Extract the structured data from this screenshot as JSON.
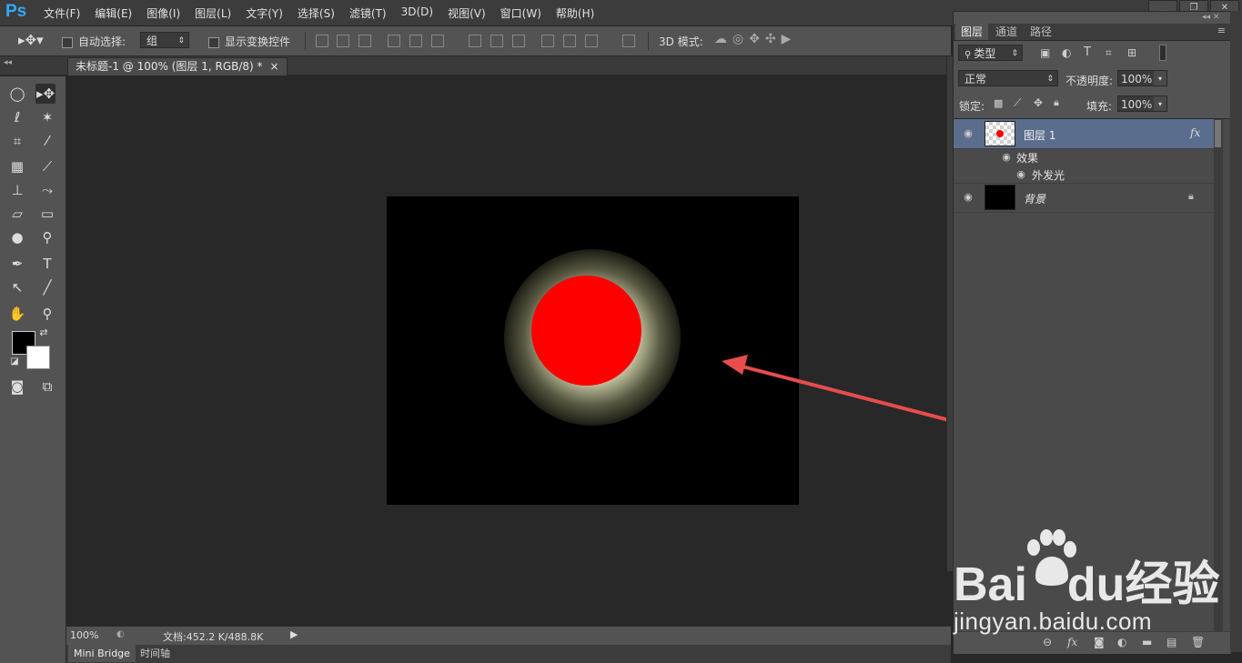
{
  "app": {
    "logo": "Ps",
    "menu": [
      "文件(F)",
      "编辑(E)",
      "图像(I)",
      "图层(L)",
      "文字(Y)",
      "选择(S)",
      "滤镜(T)",
      "3D(D)",
      "视图(V)",
      "窗口(W)",
      "帮助(H)"
    ]
  },
  "options_bar": {
    "auto_select_label": "自动选择:",
    "auto_select_value": "组",
    "show_transform_label": "显示变换控件",
    "mode_3d_label": "3D 模式:"
  },
  "document": {
    "tab_title": "未标题-1 @ 100% (图层 1, RGB/8) *",
    "tab_close": "×"
  },
  "status_bar": {
    "zoom": "100%",
    "doc_info": "文档:452.2 K/488.8K"
  },
  "bottom_tabs": [
    "Mini Bridge",
    "时间轴"
  ],
  "layers_panel": {
    "tabs": [
      "图层",
      "通道",
      "路径"
    ],
    "filter_kind": "类型",
    "blend_mode": "正常",
    "opacity_label": "不透明度:",
    "opacity_value": "100%",
    "lock_label": "锁定:",
    "fill_label": "填充:",
    "fill_value": "100%",
    "layers": [
      {
        "name": "图层 1",
        "fx": "fx",
        "effects_label": "效果",
        "effect": "外发光"
      },
      {
        "name": "背景"
      }
    ]
  },
  "watermark": {
    "brand_a": "Bai",
    "brand_b": "du",
    "brand_c": "经验",
    "url": "jingyan.baidu.com"
  },
  "colors": {
    "circle": "#ff0000",
    "glow": "#f5f5cd",
    "arrow": "#e84c4c",
    "foreground": "#000000",
    "background": "#ffffff"
  }
}
